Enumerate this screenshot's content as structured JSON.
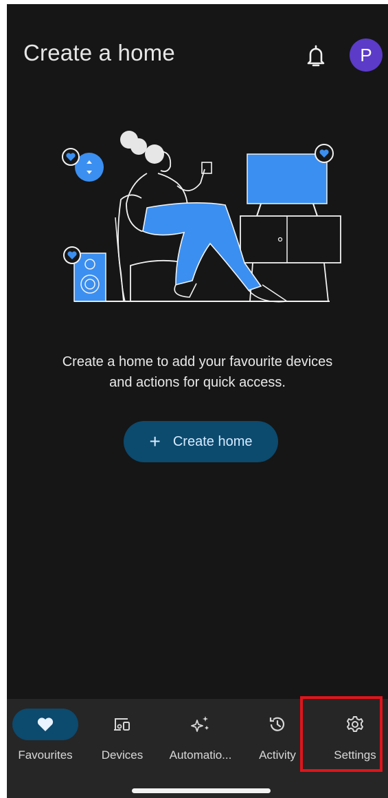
{
  "header": {
    "title": "Create a home",
    "notifications_icon": "bell-icon",
    "avatar_initial": "P",
    "avatar_color": "#5b3bc8"
  },
  "empty_state": {
    "illustration": "person-relaxing-with-smart-devices",
    "message_line1": "Create a home to add your favourite devices",
    "message_line2": "and actions for quick access.",
    "button_icon": "plus-icon",
    "button_label": "Create home"
  },
  "bottom_nav": {
    "items": [
      {
        "label": "Favourites",
        "icon": "heart-icon",
        "active": true
      },
      {
        "label": "Devices",
        "icon": "devices-icon",
        "active": false
      },
      {
        "label": "Automatio...",
        "icon": "sparkle-icon",
        "active": false
      },
      {
        "label": "Activity",
        "icon": "history-icon",
        "active": false
      },
      {
        "label": "Settings",
        "icon": "gear-icon",
        "active": false
      }
    ]
  },
  "colors": {
    "background": "#161616",
    "nav_background": "#262626",
    "accent_blue": "#3b8ff0",
    "active_pill": "#0c4a6e",
    "highlight": "#e0141b"
  }
}
